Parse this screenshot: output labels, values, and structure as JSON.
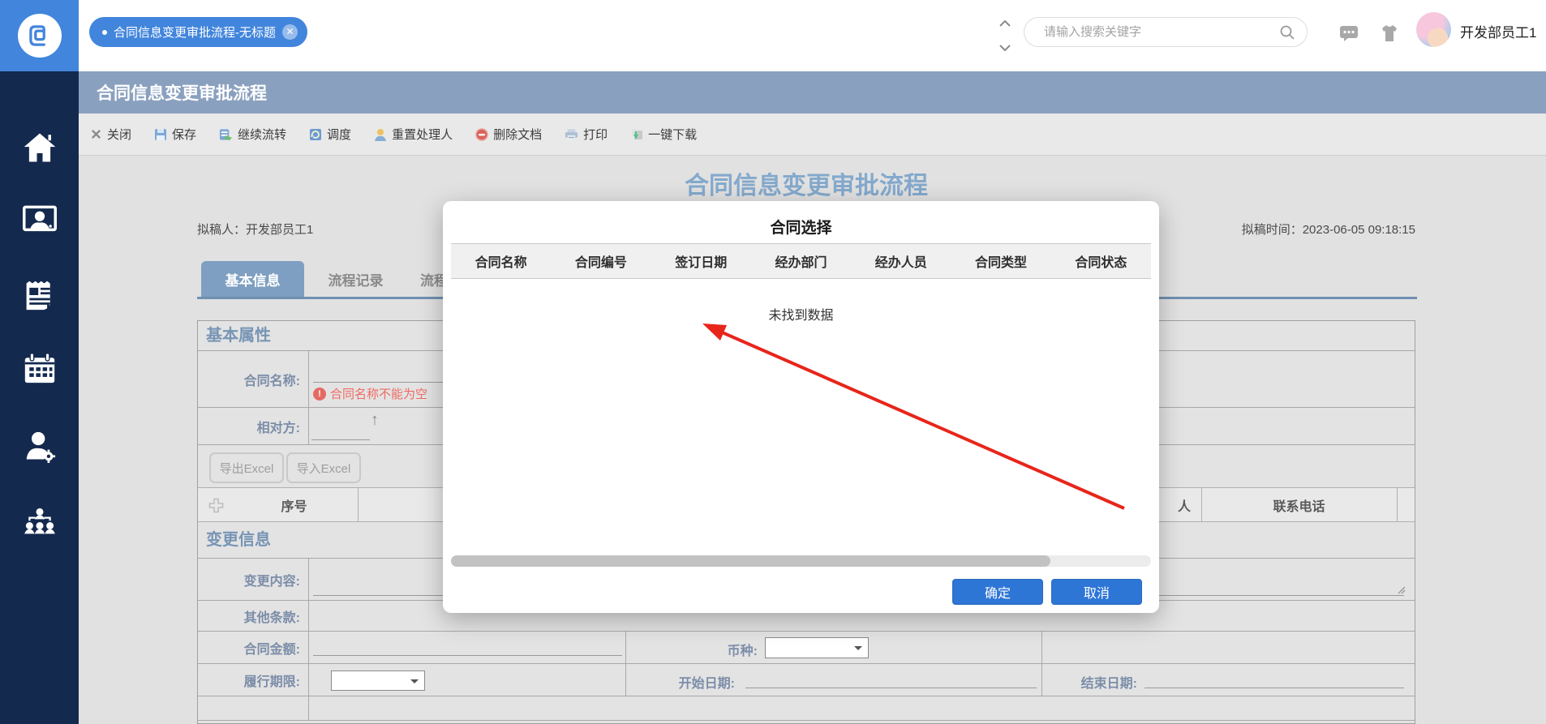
{
  "topbar": {
    "tab_label": "合同信息变更审批流程-无标题",
    "search_placeholder": "请输入搜索关键字",
    "username": "开发部员工1"
  },
  "titlebar": {
    "title": "合同信息变更审批流程"
  },
  "toolbar": {
    "items": [
      {
        "icon": "close-icon",
        "label": "关闭"
      },
      {
        "icon": "save-icon",
        "label": "保存"
      },
      {
        "icon": "continue-flow-icon",
        "label": "继续流转"
      },
      {
        "icon": "dispatch-icon",
        "label": "调度"
      },
      {
        "icon": "reset-handler-icon",
        "label": "重置处理人"
      },
      {
        "icon": "delete-doc-icon",
        "label": "删除文档"
      },
      {
        "icon": "print-icon",
        "label": "打印"
      },
      {
        "icon": "download-icon",
        "label": "一键下载"
      }
    ]
  },
  "sidebar": {
    "items": [
      {
        "icon": "home-icon"
      },
      {
        "icon": "workspace-monitor-icon"
      },
      {
        "icon": "news-icon"
      },
      {
        "icon": "calendar-icon"
      },
      {
        "icon": "user-settings-icon"
      },
      {
        "icon": "org-chart-icon"
      }
    ]
  },
  "main": {
    "heading": "合同信息变更审批流程",
    "drafter": "拟稿人：开发部员工1",
    "draft_time": "拟稿时间：2023-06-05 09:18:15",
    "tabs": [
      {
        "label": "基本信息",
        "active": true
      },
      {
        "label": "流程记录",
        "active": false
      },
      {
        "label": "流程图",
        "active": false
      }
    ]
  },
  "form": {
    "section_basic": "基本属性",
    "section_change": "变更信息",
    "fields": {
      "contract_name": "合同名称:",
      "contract_name_error": "合同名称不能为空",
      "counterparty": "相对方:",
      "change_content": "变更内容:",
      "other_terms": "其他条款:",
      "contract_amount": "合同金额:",
      "currency": "币种:",
      "duration": "履行期限:",
      "start_date": "开始日期:",
      "end_date": "结束日期:"
    },
    "excel": {
      "export_label": "导出Excel",
      "import_label": "导入Excel"
    },
    "grid": {
      "col_seq": "序号",
      "col_partial": "人",
      "col_phone": "联系电话"
    }
  },
  "modal": {
    "title": "合同选择",
    "columns": [
      "合同名称",
      "合同编号",
      "签订日期",
      "经办部门",
      "经办人员",
      "合同类型",
      "合同状态"
    ],
    "empty_text": "未找到数据",
    "ok_label": "确定",
    "cancel_label": "取消"
  },
  "colors": {
    "brand_blue": "#4285dc",
    "sidebar_navy": "#13294e",
    "titlebar_blue_gray": "#8aa0bf",
    "heading_steel_blue": "#84a9cc",
    "active_tab_blue": "#7e9fc1",
    "label_blue_gray": "#7b8da8",
    "error_red": "#ef6a63",
    "button_blue": "#2e76d6",
    "annotation_arrow_red": "#e8251b"
  }
}
